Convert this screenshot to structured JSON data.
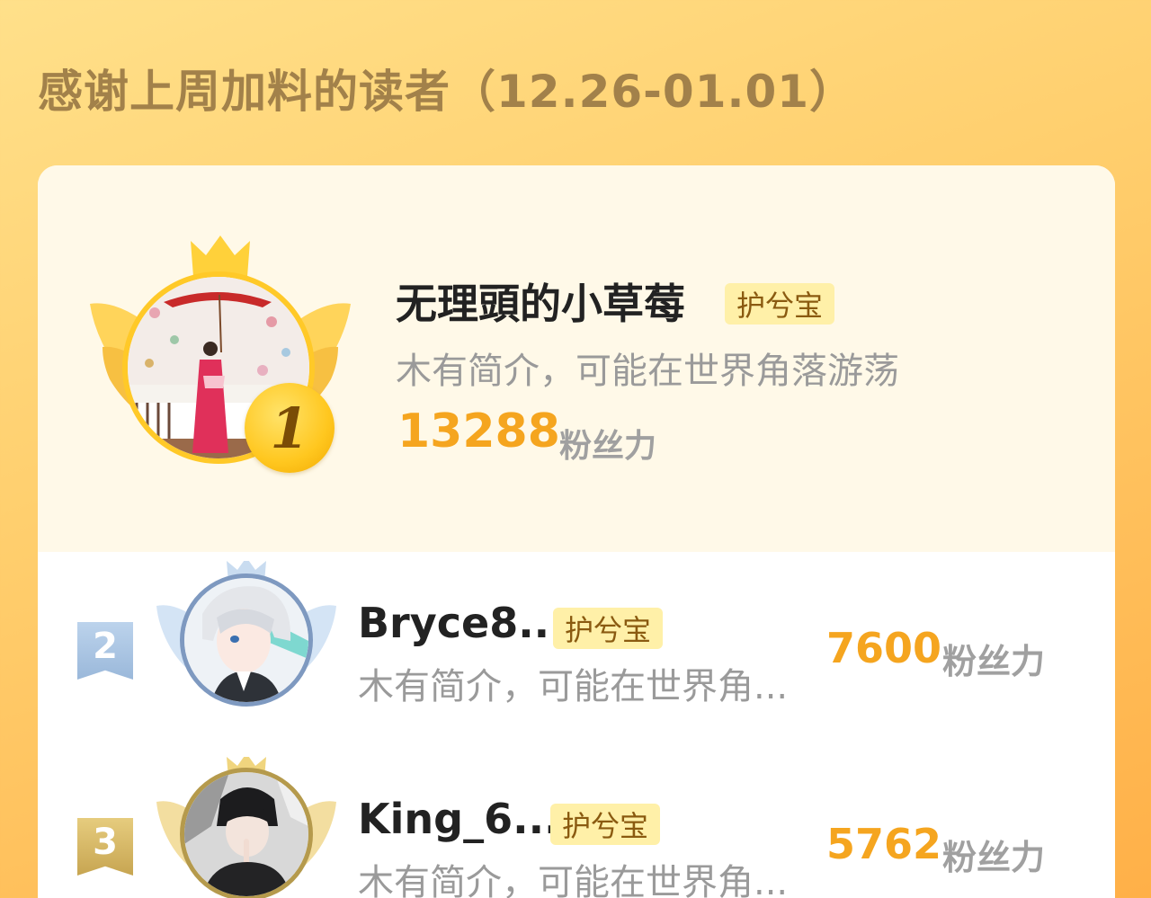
{
  "page": {
    "title": "感谢上周加料的读者（12.26-01.01）"
  },
  "colors": {
    "background_top": "#ffe08a",
    "background_bottom": "#ffb048",
    "title": "#a2814a",
    "score": "#f5a51f",
    "badge_bg": "#fff0a8",
    "badge_text": "#8a5a10",
    "medal_gold": "#ffc71f",
    "rank_silver": "#9ab8da",
    "rank_bronze": "#c7a551"
  },
  "readers": [
    {
      "rank": "1",
      "name": "无理頭的小草莓",
      "badge": "护兮宝",
      "bio": "木有简介，可能在世界角落游荡",
      "score": "13288",
      "score_unit": "粉丝力",
      "frame": "gold-wings-crown",
      "avatar": "kimono-umbrella-photo"
    },
    {
      "rank": "2",
      "name": "Bryce8...",
      "badge": "护兮宝",
      "bio": "木有简介，可能在世界角...",
      "score": "7600",
      "score_unit": "粉丝力",
      "frame": "silver-wings-crown",
      "avatar": "anime-white-hair-boy"
    },
    {
      "rank": "3",
      "name": "King_6...",
      "badge": "护兮宝",
      "bio": "木有简介，可能在世界角...",
      "score": "5762",
      "score_unit": "粉丝力",
      "frame": "bronze-wings-crown",
      "avatar": "dark-hair-boy-finger-on-lips"
    }
  ]
}
